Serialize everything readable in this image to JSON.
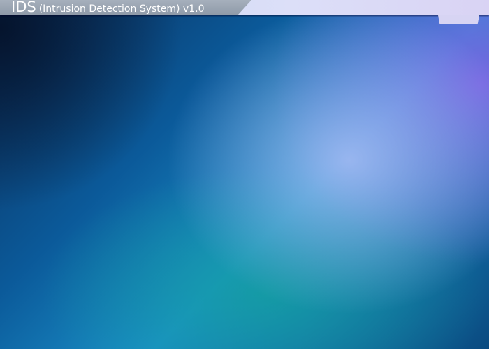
{
  "header": {
    "app_name": "IDS",
    "subtitle": "(Intrusion Detection System) v1.0"
  },
  "colors": {
    "title_bar_left": "#98a4b2",
    "title_bar_right": "#dcdff8",
    "background_accent": "#1a8fc8"
  }
}
